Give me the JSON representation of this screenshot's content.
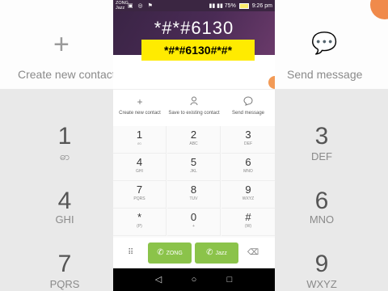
{
  "status": {
    "carrier_line1": "ZONG",
    "carrier_line2": "Jazz",
    "icons_left": "▣ ◎ ⚑",
    "battery": "75%",
    "time": "9:26 pm"
  },
  "dialer": {
    "dialed_number": "*#*#6130",
    "overlay_code": "*#*#6130#*#*"
  },
  "actions": [
    {
      "icon": "plus-icon",
      "glyph": "+",
      "label": "Create new contact"
    },
    {
      "icon": "person-icon",
      "glyph": "👤",
      "label": "Save to existing contact"
    },
    {
      "icon": "message-icon",
      "glyph": "💬",
      "label": "Send message"
    }
  ],
  "keys": [
    {
      "digit": "1",
      "letters": "ဓာ"
    },
    {
      "digit": "2",
      "letters": "ABC"
    },
    {
      "digit": "3",
      "letters": "DEF"
    },
    {
      "digit": "4",
      "letters": "GHI"
    },
    {
      "digit": "5",
      "letters": "JKL"
    },
    {
      "digit": "6",
      "letters": "MNO"
    },
    {
      "digit": "7",
      "letters": "PQRS"
    },
    {
      "digit": "8",
      "letters": "TUV"
    },
    {
      "digit": "9",
      "letters": "WXYZ"
    },
    {
      "digit": "*",
      "letters": "(P)"
    },
    {
      "digit": "0",
      "letters": "+"
    },
    {
      "digit": "#",
      "letters": "(W)"
    }
  ],
  "callbar": {
    "sim1_label": "ZONG",
    "sim2_label": "Jazz"
  },
  "background": {
    "left_label": "Create new contact",
    "right_label": "Send message",
    "left_digits": [
      {
        "digit": "1",
        "letters": "ဓာ"
      },
      {
        "digit": "4",
        "letters": "GHI"
      },
      {
        "digit": "7",
        "letters": "PQRS"
      }
    ],
    "right_digits": [
      {
        "digit": "3",
        "letters": "DEF"
      },
      {
        "digit": "6",
        "letters": "MNO"
      },
      {
        "digit": "9",
        "letters": "WXYZ"
      }
    ]
  },
  "colors": {
    "header": "#3a2445",
    "call_button": "#8bc34a",
    "highlight": "#ffeb00",
    "accent": "#f29a56"
  }
}
